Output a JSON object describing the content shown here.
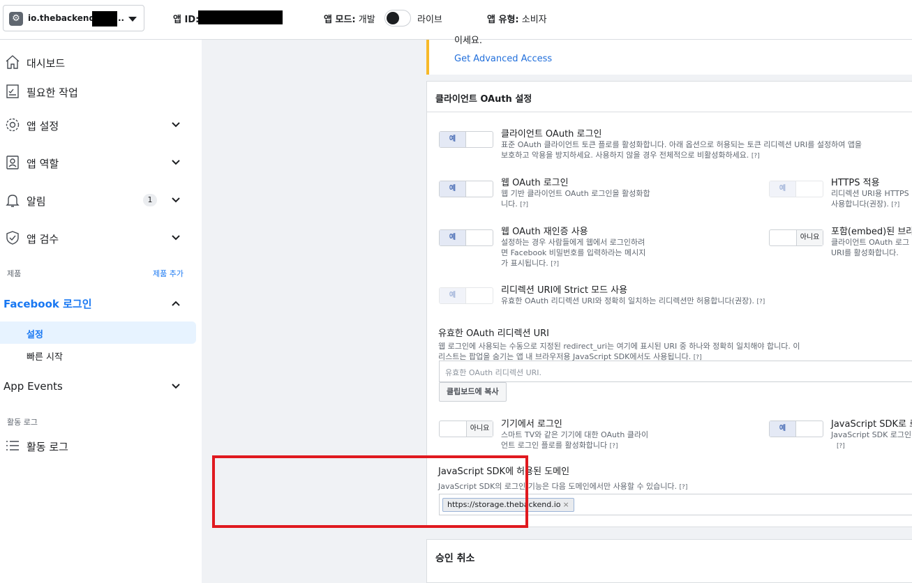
{
  "topbar": {
    "app_name": "io.thebackend.",
    "app_name_suffix": "..",
    "app_id_label": "앱 ID:",
    "mode_label": "앱 모드:",
    "mode_dev": "개발",
    "mode_live": "라이브",
    "type_label": "앱 유형:",
    "type_value": "소비자"
  },
  "sidebar": {
    "items": [
      {
        "label": "대시보드",
        "icon": "home-icon"
      },
      {
        "label": "필요한 작업",
        "icon": "checklist-icon"
      },
      {
        "label": "앱 설정",
        "icon": "gear-icon"
      },
      {
        "label": "앱 역할",
        "icon": "id-badge-icon"
      },
      {
        "label": "알림",
        "icon": "bell-icon",
        "badge": "1"
      },
      {
        "label": "앱 검수",
        "icon": "shield-check-icon"
      }
    ],
    "products_label": "제품",
    "add_product": "제품 추가",
    "facebook_login": "Facebook 로그인",
    "sub_items": [
      "설정",
      "빠른 시작"
    ],
    "app_events": "App Events",
    "activity_section": "활동 로그",
    "activity_item": "활동 로그"
  },
  "main": {
    "top_card": {
      "cut_text": "이세요.",
      "link": "Get Advanced Access"
    },
    "oauth_card": {
      "title": "클라이언트 OAuth 설정",
      "yes": "예",
      "no": "아니요",
      "client_oauth": {
        "title": "클라이언트 OAuth 로그인",
        "desc1": "표준 OAuth 클라이언트 토큰 플로를 활성화합니다. 아래 옵션으로 허용되는 토큰 리디렉션 URI를 설정하여 앱을",
        "desc2": "보호하고 악용을 방지하세요. 사용하지 않을 경우 전체적으로 비활성화하세요."
      },
      "web_oauth": {
        "title": "웹 OAuth 로그인",
        "desc1": "웹 기반 클라이언트 OAuth 로그인을 활성화합",
        "desc2": "니다."
      },
      "https": {
        "title": "HTTPS 적용",
        "desc1": "리디렉션 URI용 HTTPS",
        "desc2": "사용합니다(권장)."
      },
      "reauth": {
        "title": "웹 OAuth 재인증 사용",
        "desc1": "설정하는 경우 사람들에게 웹에서 로그인하려",
        "desc2": "면 Facebook 비밀번호를 입력하라는 메시지",
        "desc3": "가 표시됩니다."
      },
      "embedded": {
        "title": "포함(embed)된 브라",
        "desc1": "클라이언트 OAuth 로그",
        "desc2": "URI를 활성화합니다."
      },
      "strict": {
        "title": "리디렉션 URI에 Strict 모드 사용",
        "desc": "유효한 OAuth 리디렉션 URI와 정확히 일치하는 리디렉션만 허용합니다(권장)."
      },
      "valid_uri": {
        "label": "유효한 OAuth 리디렉션 URI",
        "desc1": "웹 로그인에 사용되는 수동으로 지정된 redirect_uri는 여기에 표시된 URI 중 하나와 정확히 일치해야 합니다. 이",
        "desc2": "리스트는 팝업을 숨기는 앱 내 브라우저용 JavaScript SDK에서도 사용됩니다.",
        "placeholder": "유효한 OAuth 리디렉션 URI.",
        "copy_button": "클립보드에 복사"
      },
      "device_login": {
        "title": "기기에서 로그인",
        "desc1": "스마트 TV와 같은 기기에 대한 OAuth 클라이",
        "desc2": "언트 로그인 플로를 활성화합니다"
      },
      "js_sdk_login": {
        "title": "JavaScript SDK로 로",
        "desc": "JavaScript SDK 로그인"
      },
      "js_domains": {
        "title": "JavaScript SDK에 허용된 도메인",
        "desc": "JavaScript SDK의 로그인 기능은 다음 도메인에서만 사용할 수 있습니다.",
        "tag": "https://storage.thebackend.io",
        "tag_remove": "×"
      },
      "help": "[?]"
    },
    "revoke_card": {
      "title": "승인 취소"
    }
  },
  "colors": {
    "accent": "#1877f2",
    "highlight_border": "#e0191f",
    "warning_border": "#f7b928"
  }
}
